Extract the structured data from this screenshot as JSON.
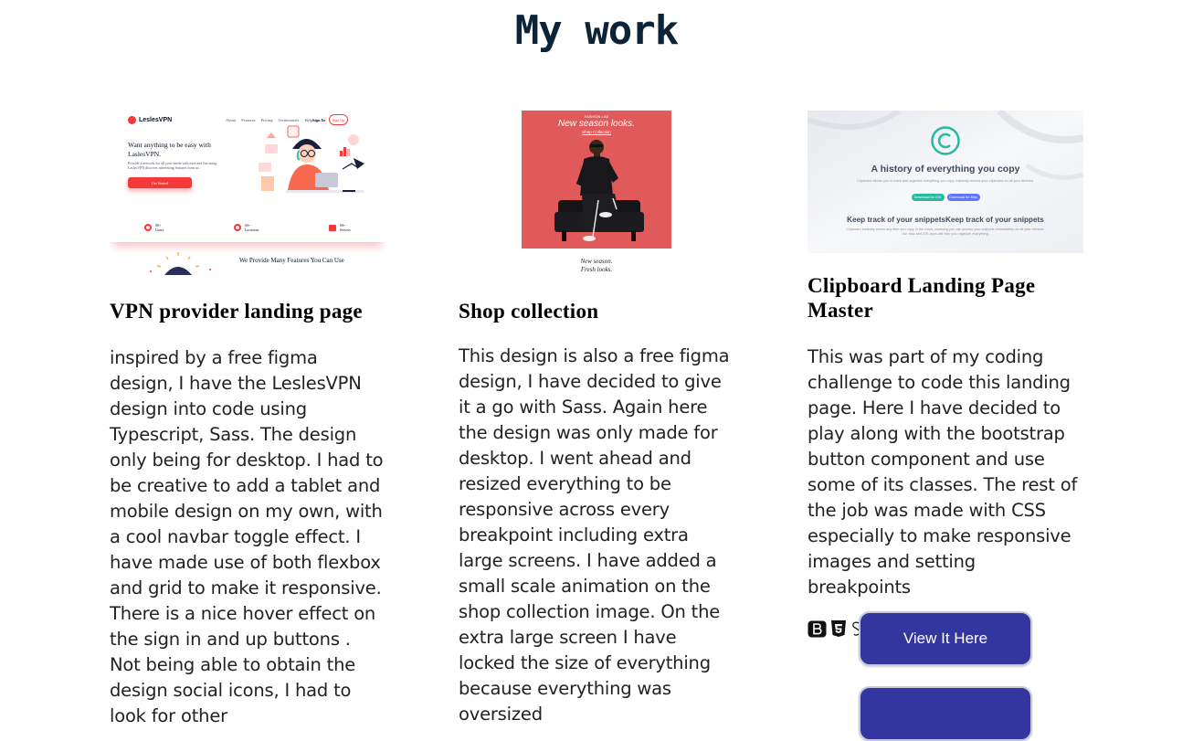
{
  "header": {
    "title": "My work"
  },
  "projects": [
    {
      "title": "VPN provider landing page",
      "description": "inspired by a free figma design, I have the LeslesVPN design into code using Typescript, Sass. The design only being for desktop. I had to be creative to add a tablet and mobile design on my own, with a cool navbar toggle effect. I have made use of both flexbox and grid to make it responsive. There is a nice hover effect on the sign in and up buttons . Not being able to obtain the design social icons, I had to look for other",
      "thumbnail": {
        "brand": "LeslesVPN",
        "nav": [
          "About",
          "Features",
          "Pricing",
          "Testimonials",
          "Help"
        ],
        "sign_in": "Sign In",
        "sign_up": "Sign Up",
        "headline": "Want anything to be easy with LaslesVPN.",
        "sub": "Provide a network for all your needs with ease and fun using LaslesVPN discover interesting features from us.",
        "cta": "Get Started",
        "stats": [
          {
            "value": "90+",
            "label": "Users"
          },
          {
            "value": "30+",
            "label": "Locations"
          },
          {
            "value": "50+",
            "label": "Servers"
          }
        ],
        "features_heading": "We Provide Many Features You Can Use"
      }
    },
    {
      "title": "Shop collection",
      "description": "This design is also a free figma design, I have decided to give it a go with Sass. Again here the design was only made for desktop. I went ahead and resized everything to be responsive across every breakpoint including extra large screens. I have added a small scale animation on the shop collection image. On the extra large screen I have locked the size of everything because everything was oversized",
      "thumbnail": {
        "kicker": "FASHION LAB",
        "headline": "New season looks.",
        "link": "Shop Collection",
        "footer_line1": "New season.",
        "footer_line2": "Fresh looks.",
        "bg_color": "#e05a5c"
      }
    },
    {
      "title": "Clipboard Landing Page Master",
      "description": "This was part of my coding challenge to code this landing page. Here I have decided to play along with the bootstrap button component and use some of its classes. The rest of the job was made with CSS especially to make responsive images and setting breakpoints",
      "thumbnail": {
        "headline": "A history of everything you copy",
        "sub": "Clipboard allows you to track and organize everything you copy. Instantly access your clipboard on all your devices.",
        "btn_ios": "Download for iOS",
        "btn_mac": "Download for Mac",
        "section_heading": "Keep track of your snippetsKeep track of your snippets",
        "section_text": "Clipboard instantly stores any item you copy in the cloud, meaning you can access your snippets immediately on all your devices. Our Mac and iOS apps will help you organize everything."
      },
      "tech_icons": [
        "bootstrap-icon",
        "html5-icon",
        "sass-icon"
      ],
      "buttons": {
        "view": "View It Here",
        "code": ""
      }
    }
  ],
  "colors": {
    "title": "#0d2438",
    "button": "#33369e",
    "vpn_accent": "#f53838"
  }
}
